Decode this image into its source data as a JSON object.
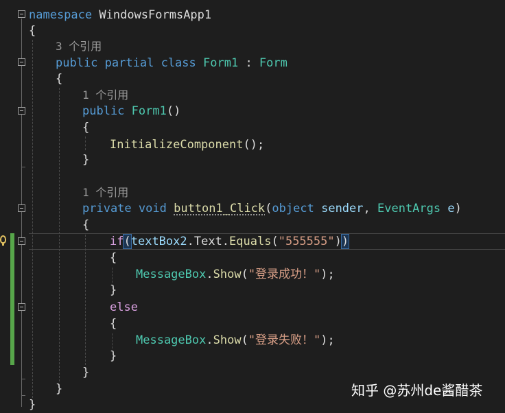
{
  "codelens": {
    "form1_class": "3 个引用",
    "form1_ctor": "1 个引用",
    "button1_click": "1 个引用"
  },
  "code": {
    "ns_keyword": "namespace",
    "ns_name": "WindowsFormsApp1",
    "open_brace": "{",
    "close_brace": "}",
    "kw_public": "public",
    "kw_partial": "partial",
    "kw_class": "class",
    "class_name": "Form1",
    "colon": " : ",
    "base_class": "Form",
    "ctor_name": "Form1",
    "empty_parens": "()",
    "init_call": "InitializeComponent",
    "call_end": "();",
    "kw_private": "private",
    "kw_void": "void",
    "method_name": "button1_Click",
    "lparen": "(",
    "rparen": ")",
    "kw_object": "object",
    "param_sender": "sender",
    "comma": ", ",
    "event_args": "EventArgs",
    "param_e": "e",
    "kw_if": "if",
    "textbox": "textBox2",
    "dot_text": ".Text.",
    "equals": "Equals",
    "str_pass": "\"555555\"",
    "msgbox": "MessageBox",
    "dot": ".",
    "show": "Show",
    "str_success": "\"登录成功！\"",
    "str_fail": "\"登录失败！\"",
    "call_close": ");",
    "kw_else": "else"
  },
  "watermark": "知乎 @苏州de酱醋茶"
}
